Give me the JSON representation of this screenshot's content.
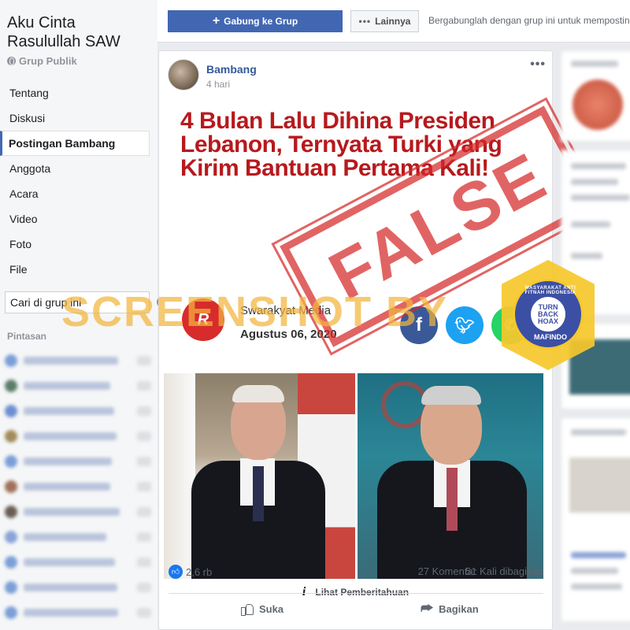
{
  "group": {
    "name": "Aku Cinta Rasulullah SAW",
    "type": "Grup Publik"
  },
  "nav": [
    {
      "label": "Tentang"
    },
    {
      "label": "Diskusi"
    },
    {
      "label": "Postingan Bambang",
      "active": true
    },
    {
      "label": "Anggota"
    },
    {
      "label": "Acara"
    },
    {
      "label": "Video"
    },
    {
      "label": "Foto"
    },
    {
      "label": "File"
    }
  ],
  "group_search": {
    "placeholder": "Cari di grup ini"
  },
  "shortcuts": {
    "title": "Pintasan"
  },
  "topbar": {
    "join_label": "Gabung ke Grup",
    "more_label": "Lainnya",
    "join_hint": "Bergabunglah dengan grup ini untuk mempostin"
  },
  "post": {
    "author": "Bambang",
    "time": "4 hari",
    "image": {
      "headline": "4 Bulan Lalu Dihina Presiden Lebanon, Ternyata Turki yang Kirim Bantuan Pertama Kali!",
      "media_logo": "R",
      "media_name": "Swarakyat Media",
      "media_date": "Agustus 06, 2020",
      "share_icons": [
        "facebook-icon",
        "twitter-icon",
        "whatsapp-icon"
      ]
    },
    "stamp": "FALSE",
    "watermark": "SCREENSHOT BY",
    "badge": {
      "top": "TURN BACK HOAX",
      "ring": "MASYARAKAT ANTI FITNAH INDONESIA",
      "name": "MAFINDO"
    },
    "notice": "Lihat Pemberitahuan",
    "reactions": "2,6 rb",
    "comments": "27 Komentar",
    "shares": "51 Kali dibagikan",
    "like_label": "Suka",
    "share_label": "Bagikan"
  },
  "colors": {
    "brand": "#4267b2",
    "link": "#365899",
    "headline_red": "#b7191d",
    "stamp_red": "#d62828",
    "watermark_orange": "#f3b43c",
    "badge_yellow": "#f6c82b"
  }
}
